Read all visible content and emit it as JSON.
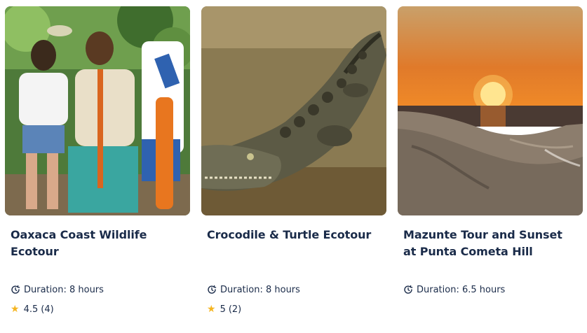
{
  "colors": {
    "title_text": "#1a2b49",
    "meta_text": "#1a2b49",
    "star": "#f5b521"
  },
  "cards": [
    {
      "image_alt": "tourists walking in a forest",
      "title": "Oaxaca Coast Wildlife Ecotour",
      "duration": "Duration: 8 hours",
      "rating": "4.5",
      "reviews": "(4)"
    },
    {
      "image_alt": "crocodile resting near water",
      "title": "Crocodile & Turtle Ecotour",
      "duration": "Duration: 8 hours",
      "rating": "5",
      "reviews": "(2)"
    },
    {
      "image_alt": "sunset over ocean and rocky hill",
      "title": "Mazunte Tour and Sunset at Punta Cometa Hill",
      "duration": "Duration: 6.5 hours"
    }
  ],
  "icons": {
    "duration": "clock-refresh-icon",
    "rating": "star-icon"
  }
}
